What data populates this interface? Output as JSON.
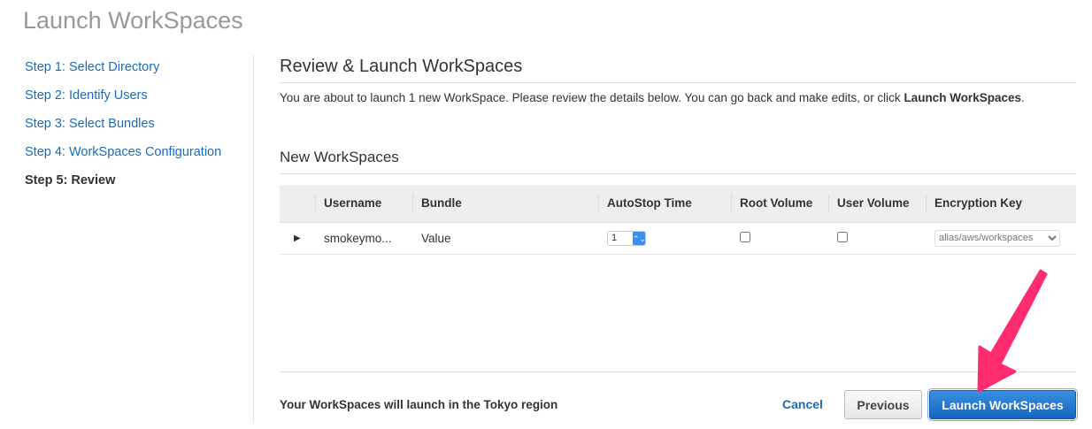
{
  "page_title": "Launch WorkSpaces",
  "steps": [
    "Step 1: Select Directory",
    "Step 2: Identify Users",
    "Step 3: Select Bundles",
    "Step 4: WorkSpaces Configuration",
    "Step 5: Review"
  ],
  "main": {
    "title": "Review & Launch WorkSpaces",
    "desc_prefix": "You are about to launch 1 new WorkSpace. Please review the details below. You can go back and make edits, or click ",
    "desc_bold": "Launch WorkSpaces",
    "desc_suffix": ".",
    "section": "New WorkSpaces"
  },
  "table": {
    "headers": [
      "Username",
      "Bundle",
      "AutoStop Time",
      "Root Volume",
      "User Volume",
      "Encryption Key"
    ],
    "row": {
      "username": "smokeymo...",
      "bundle": "Value",
      "autostop": "1",
      "encryption": "alias/aws/workspaces"
    }
  },
  "footer": {
    "region": "Your WorkSpaces will launch in the Tokyo region",
    "cancel": "Cancel",
    "previous": "Previous",
    "launch": "Launch WorkSpaces"
  },
  "colors": {
    "accent": "#1a6bbf",
    "arrow": "#ff2d6f"
  }
}
